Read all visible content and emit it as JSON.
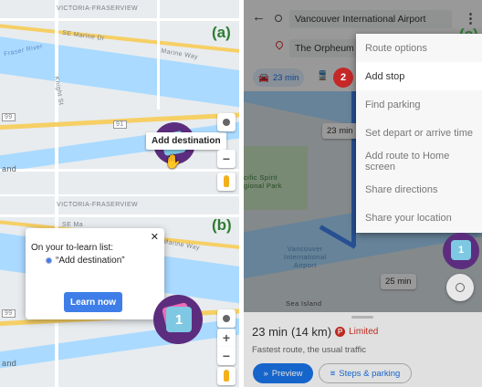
{
  "panel_a": {
    "tag": "(a)",
    "map_labels": {
      "district": "VICTORIA-FRASERVIEW",
      "se_marine": "SE Marine Dr",
      "fraser_river": "Fraser River",
      "marine_way": "Marine Way",
      "knight": "Knight St",
      "route_91": "91",
      "route_99": "99",
      "land": "and"
    },
    "tooltip": "Add destination",
    "buttons": {
      "zoom_in": "+",
      "zoom_out": "−"
    }
  },
  "panel_b": {
    "tag": "(b)",
    "map_labels": {
      "district": "VICTORIA-FRASERVIEW",
      "se_marine": "SE Ma",
      "marine_way": "Marine Way",
      "route_99": "99",
      "land": "and"
    },
    "popup": {
      "heading": "On your to-learn list:",
      "item": "“Add destination”",
      "button": "Learn now",
      "close": "✕"
    },
    "badge_number": "1",
    "buttons": {
      "zoom_in": "+",
      "zoom_out": "−"
    }
  },
  "panel_c": {
    "tag": "(c)",
    "origin": "Vancouver International Airport",
    "destination": "The Orpheum",
    "mode_time": "23 min",
    "step_number": "2",
    "menu": [
      "Route options",
      "Add stop",
      "Find parking",
      "Set depart or arrive time",
      "Add route to Home screen",
      "Share directions",
      "Share your location"
    ],
    "map_labels": {
      "chip_main": "23 min",
      "chip_alt": "25 min",
      "pacific_spirit": "cific Spirit\ngional Park",
      "airport": "Vancouver\nInternational\nAirport",
      "sea_island": "Sea Island"
    },
    "badge_number": "1",
    "summary": {
      "time": "23 min",
      "distance": "(14 km)",
      "status": "Limited",
      "subtitle": "Fastest route, the usual traffic"
    },
    "buttons": {
      "preview": "Preview",
      "steps": "Steps & parking"
    }
  },
  "colors": {
    "accent_blue": "#3f7ee8",
    "panel_tag_green": "#2e7d32",
    "badge_purple": "#5c2d7e",
    "step_badge_red": "#c62828",
    "route_blue": "#4285f4"
  }
}
